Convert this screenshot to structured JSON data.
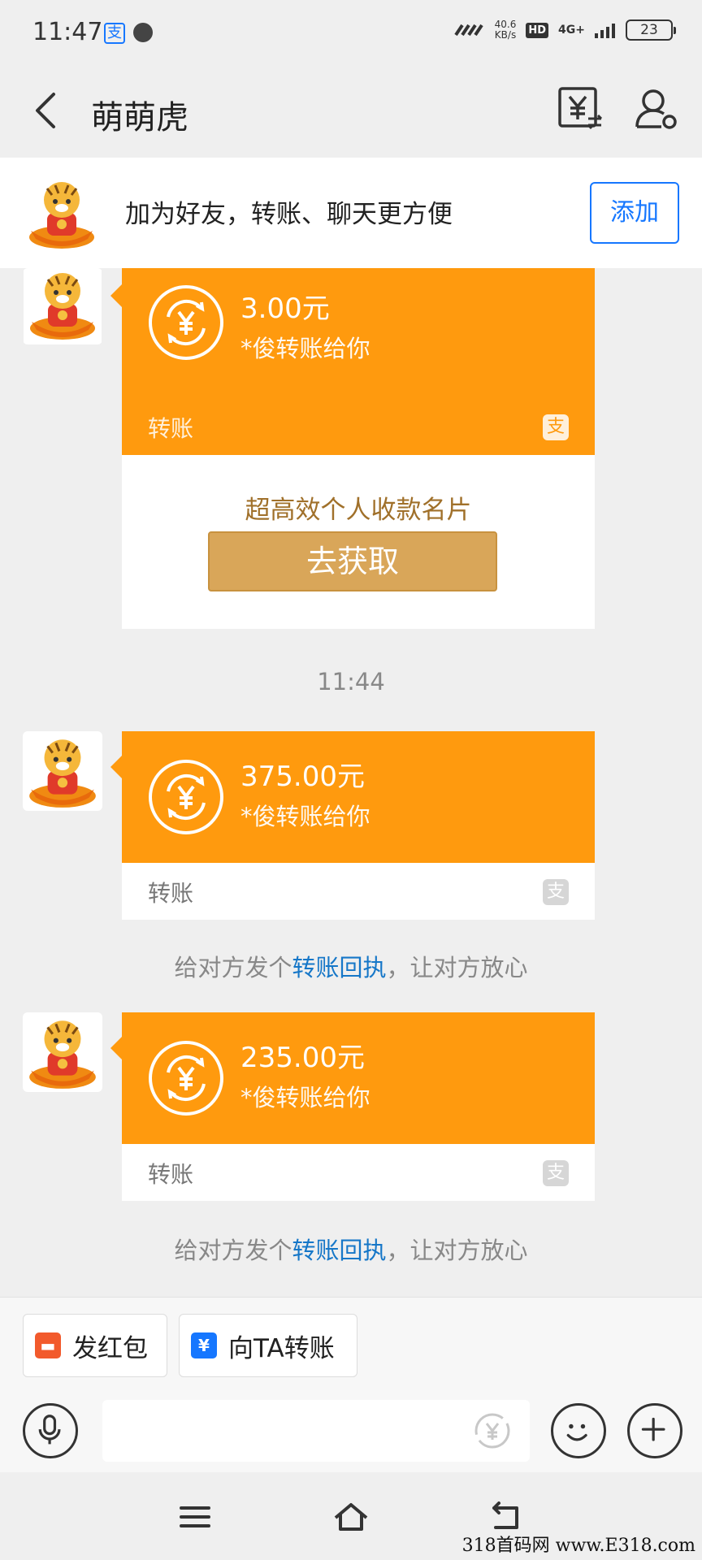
{
  "status_bar": {
    "time": "11:47",
    "net_speed_value": "40.6",
    "net_speed_unit": "KB/s",
    "hd_badge": "HD",
    "network_type": "4G+",
    "battery": "23"
  },
  "header": {
    "title": "萌萌虎"
  },
  "add_banner": {
    "text": "加为好友，转账、聊天更方便",
    "add_button": "添加"
  },
  "messages": [
    {
      "amount": "3.00元",
      "sender": "*俊转账给你",
      "footer_label": "转账",
      "promo_title": "超高效个人收款名片",
      "promo_button": "去获取"
    },
    {
      "amount": "375.00元",
      "sender": "*俊转账给你",
      "footer_label": "转账"
    },
    {
      "amount": "235.00元",
      "sender": "*俊转账给你",
      "footer_label": "转账"
    }
  ],
  "timestamp": "11:44",
  "receipt_hint": {
    "prefix": "给对方发个",
    "link": "转账回执",
    "suffix": "，让对方放心"
  },
  "quick_actions": {
    "red_packet": "发红包",
    "transfer": "向TA转账"
  },
  "watermark": "318首码网 www.E318.com",
  "colors": {
    "transfer_card": "#ff9a0e",
    "link_blue": "#1677c8",
    "add_button_blue": "#1677ff",
    "promo_button": "#d9a659"
  }
}
